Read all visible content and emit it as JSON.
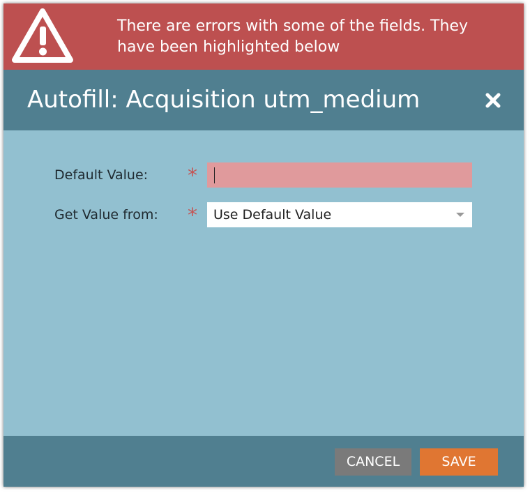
{
  "error_banner": {
    "message": "There are errors with some of the fields. They have been highlighted below",
    "icon": "warning-icon",
    "color": "#bd5050"
  },
  "dialog": {
    "title": "Autofill: Acquisition utm_medium",
    "close_icon": "close-icon",
    "header_color": "#507f90",
    "body_color": "#92c0d0"
  },
  "form": {
    "default_value": {
      "label": "Default Value:",
      "required_mark": "*",
      "value": "",
      "error_color": "#e09a9c"
    },
    "get_value_from": {
      "label": "Get Value from:",
      "required_mark": "*",
      "selected": "Use Default Value"
    }
  },
  "footer": {
    "cancel_label": "CANCEL",
    "save_label": "SAVE",
    "cancel_color": "#7a7a7a",
    "save_color": "#e07632"
  }
}
